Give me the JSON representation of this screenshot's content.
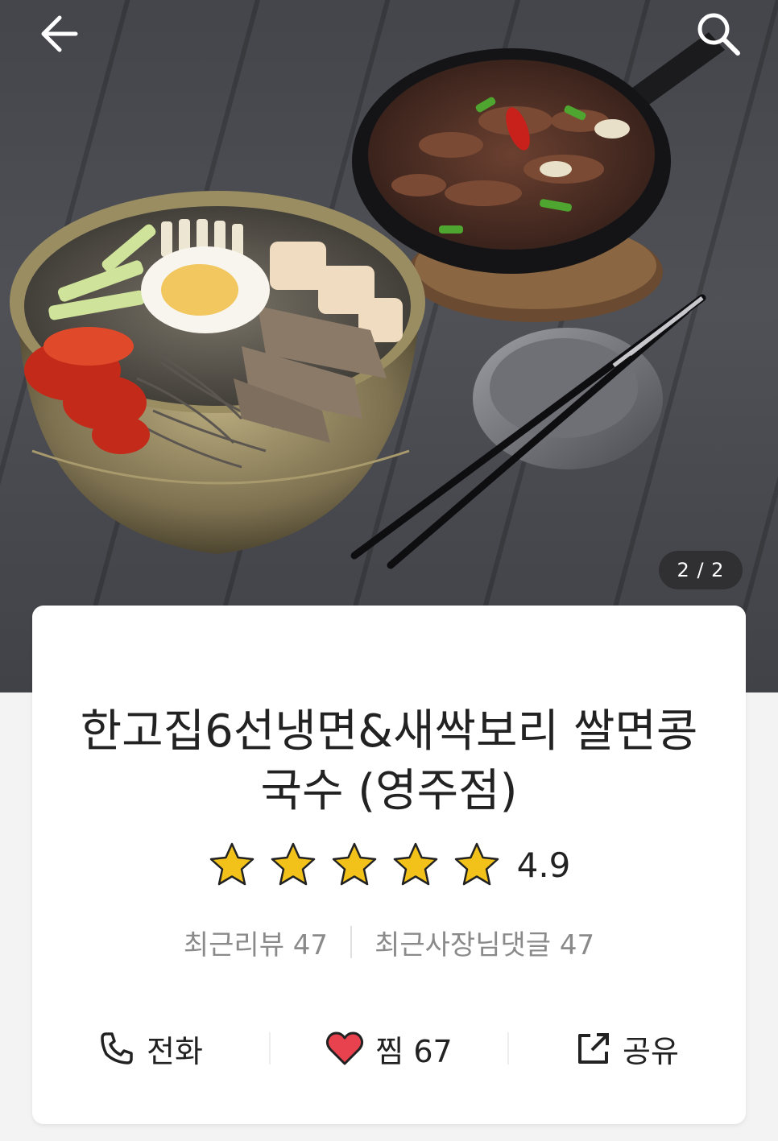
{
  "image_counter": "2 / 2",
  "restaurant": {
    "name": "한고집6선냉면&새싹보리 쌀면콩국수 (영주점)",
    "rating": "4.9",
    "stars": 5
  },
  "stats": {
    "recent_reviews": "최근리뷰 47",
    "owner_comments": "최근사장님댓글 47"
  },
  "actions": {
    "call_label": "전화",
    "favorite_label": "찜",
    "favorite_count": "67",
    "share_label": "공유"
  },
  "colors": {
    "star": "#f2c21a",
    "heart": "#e8424f"
  },
  "icons": [
    "back-arrow-icon",
    "search-icon",
    "star-icon",
    "phone-icon",
    "heart-icon",
    "share-icon"
  ]
}
